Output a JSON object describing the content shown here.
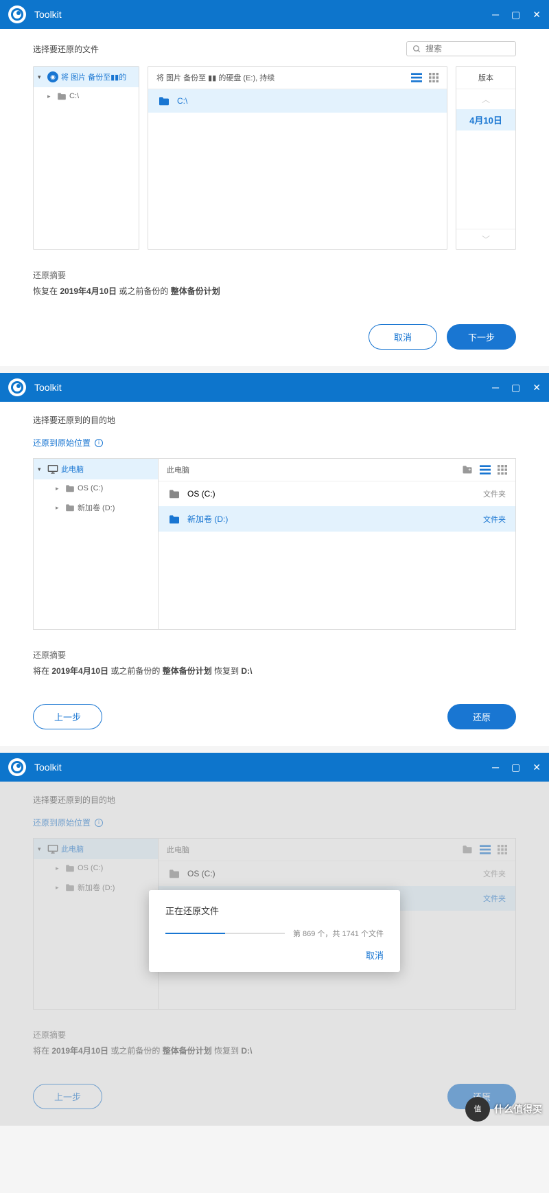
{
  "app_title": "Toolkit",
  "win1": {
    "subtitle": "选择要还原的文件",
    "search_placeholder": "搜索",
    "tree": {
      "plan_label": "将 图片 备份至",
      "plan_suffix": "的",
      "drive": "C:\\"
    },
    "breadcrumb_prefix": "将 图片 备份至",
    "breadcrumb_suffix": "的硬盘 (E:), 持续",
    "file_c": "C:\\",
    "version_title": "版本",
    "version_date": "4月10日",
    "summary_title": "还原摘要",
    "summary_prefix": "恢复在 ",
    "summary_date": "2019年4月10日",
    "summary_mid": " 或之前备份的 ",
    "summary_plan": "整体备份计划",
    "cancel": "取消",
    "next": "下一步"
  },
  "win2": {
    "subtitle": "选择要还原到的目的地",
    "restore_original": "还原到原始位置",
    "tree_root": "此电脑",
    "tree_os": "OS (C:)",
    "tree_d": "新加卷 (D:)",
    "breadcrumb": "此电脑",
    "row_os": "OS (C:)",
    "row_d": "新加卷 (D:)",
    "type_folder": "文件夹",
    "summary_title": "还原摘要",
    "summary_prefix": "将在 ",
    "summary_date": "2019年4月10日",
    "summary_mid": " 或之前备份的 ",
    "summary_plan": "整体备份计划",
    "summary_to": " 恢复到 ",
    "summary_dest": "D:\\",
    "prev": "上一步",
    "restore": "还原"
  },
  "win3": {
    "subtitle": "选择要还原到的目的地",
    "restore_original": "还原到原始位置",
    "tree_root": "此电脑",
    "tree_os": "OS (C:)",
    "tree_d": "新加卷 (D:)",
    "breadcrumb": "此电脑",
    "row_os": "OS (C:)",
    "type_folder": "文件夹",
    "summary_title": "还原摘要",
    "summary_prefix": "将在 ",
    "summary_date": "2019年4月10日",
    "summary_mid": " 或之前备份的 ",
    "summary_plan": "整体备份计划",
    "summary_to": " 恢复到 ",
    "summary_dest": "D:\\",
    "prev": "上一步",
    "restore": "还原",
    "dialog_title": "正在还原文件",
    "progress_current": 869,
    "progress_total": 1741,
    "progress_text": "第 869 个，共 1741 个文件",
    "progress_pct": 50,
    "dialog_cancel": "取消"
  },
  "watermark": {
    "circle": "值",
    "text": "什么值得买"
  }
}
